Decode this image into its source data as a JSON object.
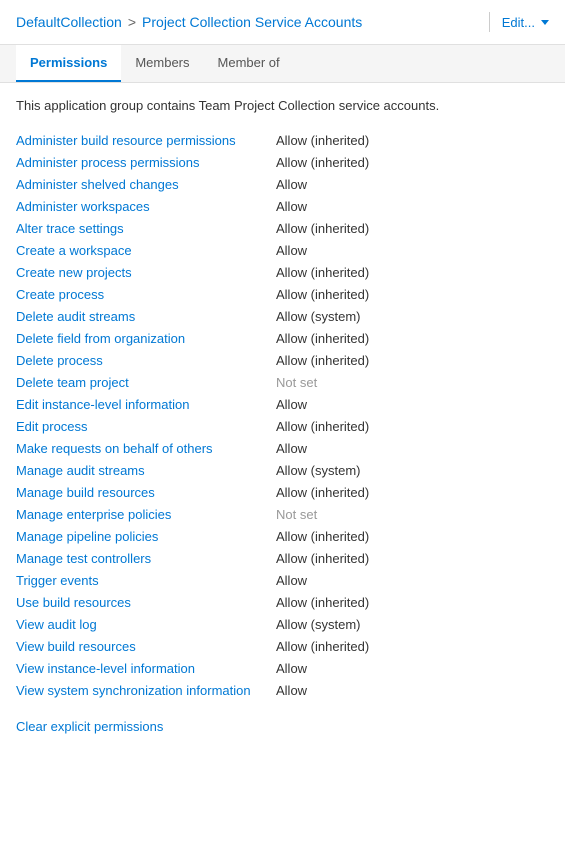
{
  "header": {
    "breadcrumb_parent": "DefaultCollection",
    "breadcrumb_separator": ">",
    "breadcrumb_current": "Project Collection Service Accounts",
    "edit_label": "Edit...",
    "chevron_icon": "chevron-down"
  },
  "tabs": [
    {
      "id": "permissions",
      "label": "Permissions",
      "active": true
    },
    {
      "id": "members",
      "label": "Members",
      "active": false
    },
    {
      "id": "member-of",
      "label": "Member of",
      "active": false
    }
  ],
  "description": "This application group contains Team Project Collection service accounts.",
  "permissions": [
    {
      "name": "Administer build resource permissions",
      "value": "Allow (inherited)"
    },
    {
      "name": "Administer process permissions",
      "value": "Allow (inherited)"
    },
    {
      "name": "Administer shelved changes",
      "value": "Allow"
    },
    {
      "name": "Administer workspaces",
      "value": "Allow"
    },
    {
      "name": "Alter trace settings",
      "value": "Allow (inherited)"
    },
    {
      "name": "Create a workspace",
      "value": "Allow"
    },
    {
      "name": "Create new projects",
      "value": "Allow (inherited)"
    },
    {
      "name": "Create process",
      "value": "Allow (inherited)"
    },
    {
      "name": "Delete audit streams",
      "value": "Allow (system)"
    },
    {
      "name": "Delete field from organization",
      "value": "Allow (inherited)"
    },
    {
      "name": "Delete process",
      "value": "Allow (inherited)"
    },
    {
      "name": "Delete team project",
      "value": "Not set"
    },
    {
      "name": "Edit instance-level information",
      "value": "Allow"
    },
    {
      "name": "Edit process",
      "value": "Allow (inherited)"
    },
    {
      "name": "Make requests on behalf of others",
      "value": "Allow"
    },
    {
      "name": "Manage audit streams",
      "value": "Allow (system)"
    },
    {
      "name": "Manage build resources",
      "value": "Allow (inherited)"
    },
    {
      "name": "Manage enterprise policies",
      "value": "Not set"
    },
    {
      "name": "Manage pipeline policies",
      "value": "Allow (inherited)"
    },
    {
      "name": "Manage test controllers",
      "value": "Allow (inherited)"
    },
    {
      "name": "Trigger events",
      "value": "Allow"
    },
    {
      "name": "Use build resources",
      "value": "Allow (inherited)"
    },
    {
      "name": "View audit log",
      "value": "Allow (system)"
    },
    {
      "name": "View build resources",
      "value": "Allow (inherited)"
    },
    {
      "name": "View instance-level information",
      "value": "Allow"
    },
    {
      "name": "View system synchronization information",
      "value": "Allow"
    }
  ],
  "clear_label": "Clear explicit permissions"
}
